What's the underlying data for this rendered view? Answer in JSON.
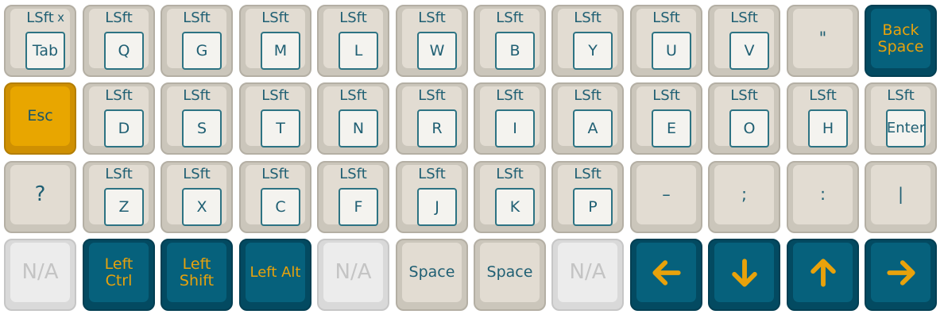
{
  "hold_label": "LSft",
  "remove_mark": "x",
  "rows": {
    "r0": {
      "k0": {
        "tap": "Tab"
      },
      "k1": {
        "tap": "Q"
      },
      "k2": {
        "tap": "G"
      },
      "k3": {
        "tap": "M"
      },
      "k4": {
        "tap": "L"
      },
      "k5": {
        "tap": "W"
      },
      "k6": {
        "tap": "B"
      },
      "k7": {
        "tap": "Y"
      },
      "k8": {
        "tap": "U"
      },
      "k9": {
        "tap": "V"
      },
      "k10": {
        "label": "\""
      },
      "k11": {
        "line1": "Back",
        "line2": "Space"
      }
    },
    "r1": {
      "k0": {
        "label": "Esc"
      },
      "k1": {
        "tap": "D"
      },
      "k2": {
        "tap": "S"
      },
      "k3": {
        "tap": "T"
      },
      "k4": {
        "tap": "N"
      },
      "k5": {
        "tap": "R"
      },
      "k6": {
        "tap": "I"
      },
      "k7": {
        "tap": "A"
      },
      "k8": {
        "tap": "E"
      },
      "k9": {
        "tap": "O"
      },
      "k10": {
        "tap": "H"
      },
      "k11": {
        "tap": "Enter"
      }
    },
    "r2": {
      "k0": {
        "label": "?"
      },
      "k1": {
        "tap": "Z"
      },
      "k2": {
        "tap": "X"
      },
      "k3": {
        "tap": "C"
      },
      "k4": {
        "tap": "F"
      },
      "k5": {
        "tap": "J"
      },
      "k6": {
        "tap": "K"
      },
      "k7": {
        "tap": "P"
      },
      "k8": {
        "label": "–"
      },
      "k9": {
        "label": ";"
      },
      "k10": {
        "label": ":"
      },
      "k11": {
        "label": "|"
      }
    },
    "r3": {
      "k0": {
        "label": "N/A"
      },
      "k1": {
        "line1": "Left",
        "line2": "Ctrl"
      },
      "k2": {
        "line1": "Left",
        "line2": "Shift"
      },
      "k3": {
        "label": "Left Alt"
      },
      "k4": {
        "label": "N/A"
      },
      "k5": {
        "label": "Space"
      },
      "k6": {
        "label": "Space"
      },
      "k7": {
        "label": "N/A"
      },
      "k8": {
        "icon": "arrow-left-icon"
      },
      "k9": {
        "icon": "arrow-down-icon"
      },
      "k10": {
        "icon": "arrow-up-icon"
      },
      "k11": {
        "icon": "arrow-right-icon"
      }
    }
  },
  "colors": {
    "plain_cap": "#e2dcd2",
    "dark_cap": "#06617c",
    "accent_orange": "#e8a600",
    "legend_teal": "#1f5f73"
  }
}
